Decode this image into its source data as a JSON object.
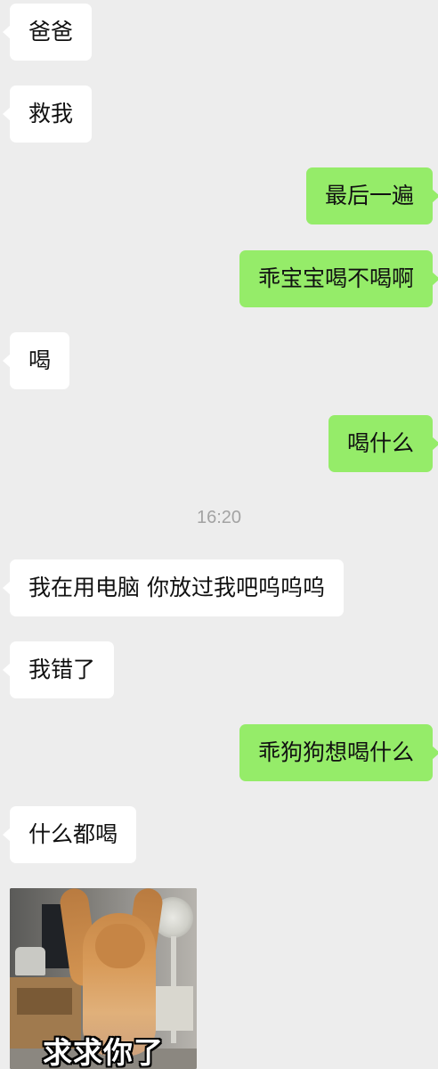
{
  "messages": [
    {
      "side": "in",
      "text": "爸爸"
    },
    {
      "side": "in",
      "text": "救我"
    },
    {
      "side": "out",
      "text": "最后一遍"
    },
    {
      "side": "out",
      "text": "乖宝宝喝不喝啊"
    },
    {
      "side": "in",
      "text": "喝"
    },
    {
      "side": "out",
      "text": "喝什么"
    },
    {
      "side": "in",
      "text": "我在用电脑 你放过我吧呜呜呜"
    },
    {
      "side": "in",
      "text": "我错了"
    },
    {
      "side": "out",
      "text": "乖狗狗想喝什么"
    },
    {
      "side": "in",
      "text": "什么都喝"
    }
  ],
  "timestamp": "16:20",
  "sticker": {
    "caption": "求求你了"
  },
  "colors": {
    "background": "#ededed",
    "incoming_bubble": "#ffffff",
    "outgoing_bubble": "#95ec69",
    "timestamp_text": "#a3a3a3"
  }
}
